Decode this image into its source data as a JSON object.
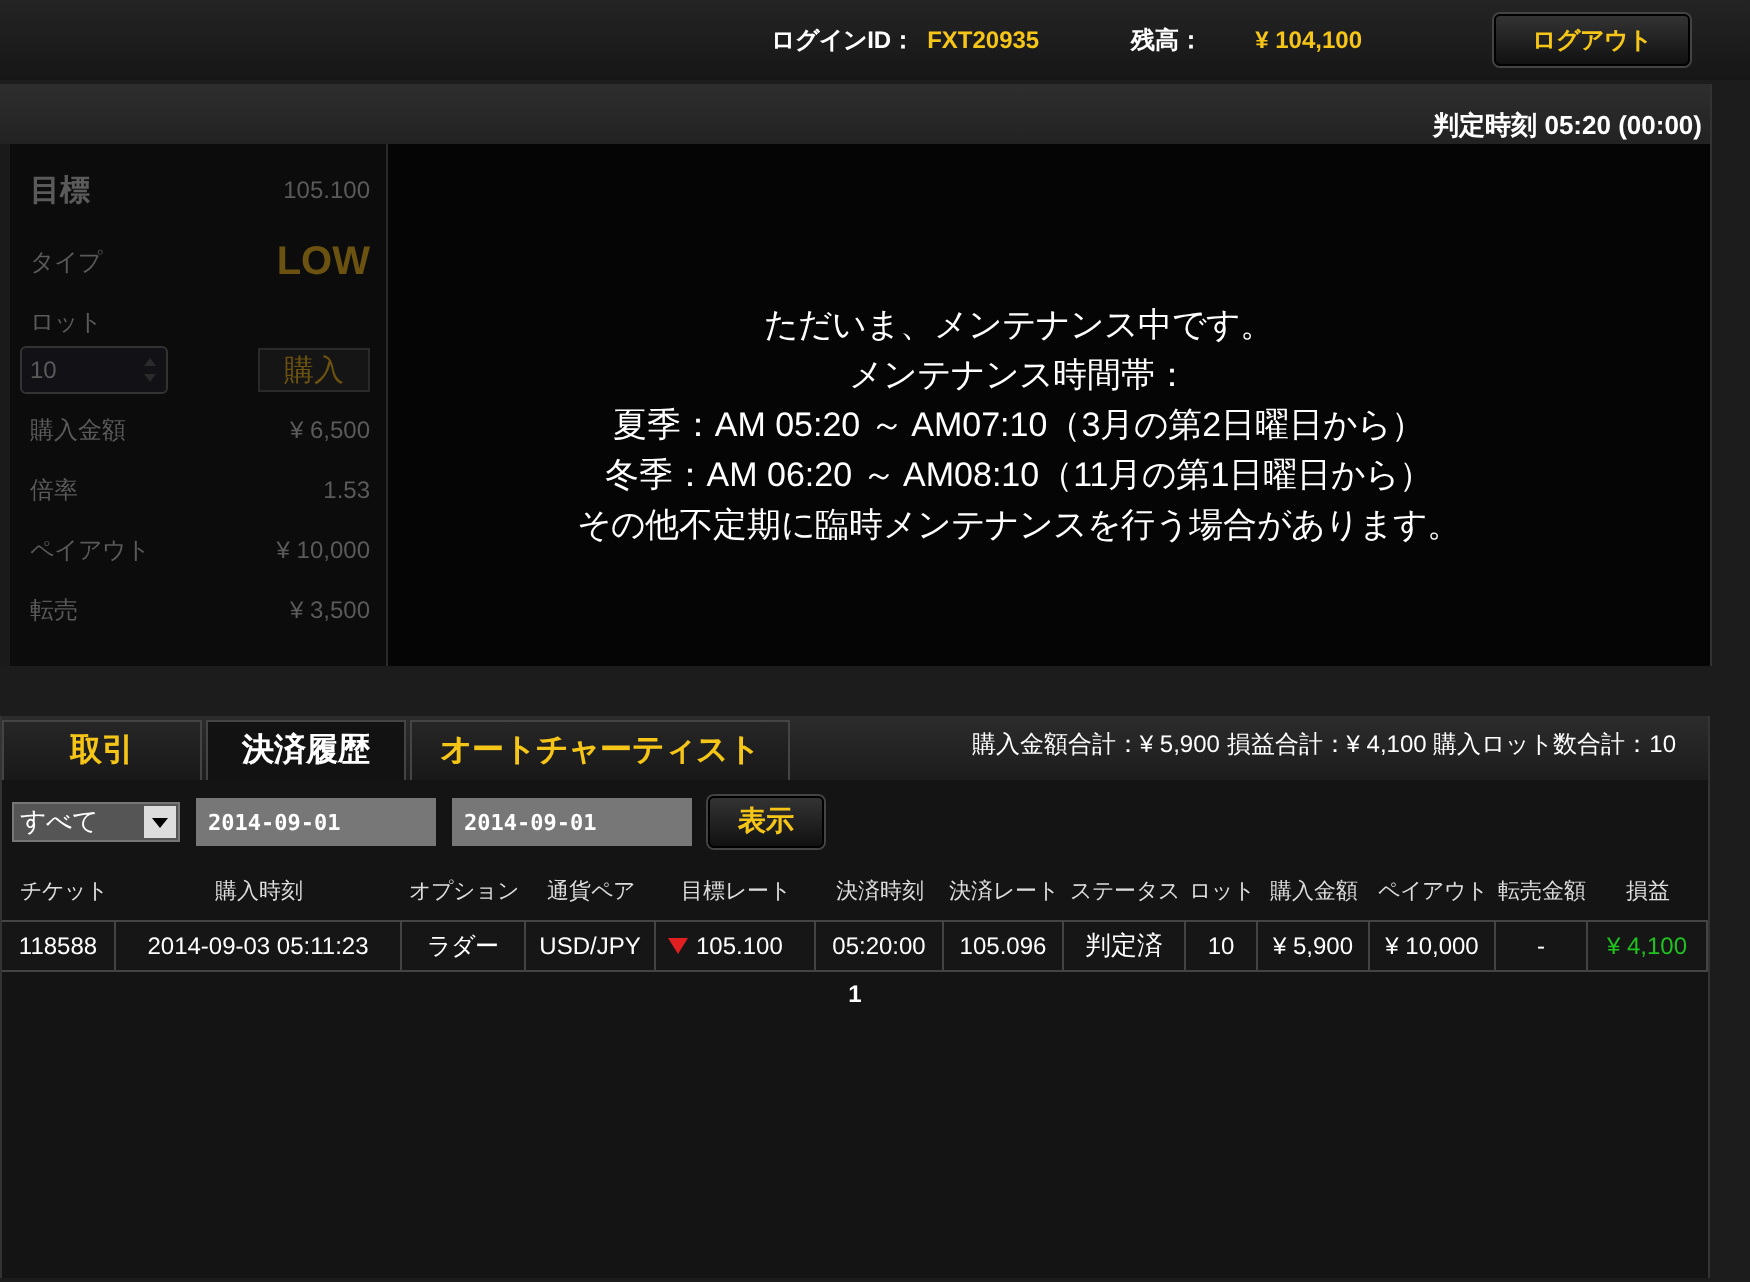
{
  "header": {
    "login_label": "ログインID：",
    "login_id": "FXT20935",
    "balance_label": "残高：",
    "balance": "¥ 104,100",
    "logout_button": "ログアウト"
  },
  "panel": {
    "judgment_time": "判定時刻 05:20 (00:00)",
    "order_form": {
      "target_label": "目標",
      "target_value": "105.100",
      "type_label": "タイプ",
      "type_value": "LOW",
      "lot_label": "ロット",
      "lot_value": "10",
      "buy_button": "購入",
      "rows": [
        {
          "label": "購入金額",
          "value": "¥ 6,500"
        },
        {
          "label": "倍率",
          "value": "1.53"
        },
        {
          "label": "ペイアウト",
          "value": "¥ 10,000"
        },
        {
          "label": "転売",
          "value": "¥ 3,500"
        }
      ]
    },
    "maintenance_message": [
      "ただいま、メンテナンス中です。",
      "メンテナンス時間帯：",
      "夏季：AM 05:20 ～ AM07:10（3月の第2日曜日から）",
      "冬季：AM 06:20 ～ AM08:10（11月の第1日曜日から）",
      "その他不定期に臨時メンテナンスを行う場合があります。"
    ]
  },
  "tabs": [
    {
      "label": "取引",
      "selected": false
    },
    {
      "label": "決済履歴",
      "selected": true
    },
    {
      "label": "オートチャーティスト",
      "selected": false
    }
  ],
  "totals": "購入金額合計：¥ 5,900 損益合計：¥ 4,100 購入ロット数合計：10",
  "filter": {
    "select_value": "すべて",
    "date_from": "2014-09-01",
    "date_to": "2014-09-01",
    "show_button": "表示"
  },
  "table": {
    "columns": [
      "チケット",
      "購入時刻",
      "オプション",
      "通貨ペア",
      "目標レート",
      "決済時刻",
      "決済レート",
      "ステータス",
      "ロット",
      "購入金額",
      "ペイアウト",
      "転売金額",
      "損益"
    ],
    "rows": [
      [
        {
          "kind": "text",
          "text": "118588"
        },
        {
          "kind": "text",
          "text": "2014-09-03 05:11:23"
        },
        {
          "kind": "text",
          "text": "ラダー"
        },
        {
          "kind": "text",
          "text": "USD/JPY"
        },
        {
          "kind": "rate",
          "text": "105.100",
          "down": true
        },
        {
          "kind": "text",
          "text": "05:20:00"
        },
        {
          "kind": "text",
          "text": "105.096"
        },
        {
          "kind": "status",
          "text": "判定済"
        },
        {
          "kind": "text",
          "text": "10"
        },
        {
          "kind": "text",
          "text": "¥ 5,900"
        },
        {
          "kind": "text",
          "text": "¥ 10,000"
        },
        {
          "kind": "text",
          "text": "-"
        },
        {
          "kind": "profit",
          "text": "¥ 4,100"
        }
      ]
    ]
  },
  "pagination": [
    {
      "label": "1",
      "selected": true
    }
  ]
}
